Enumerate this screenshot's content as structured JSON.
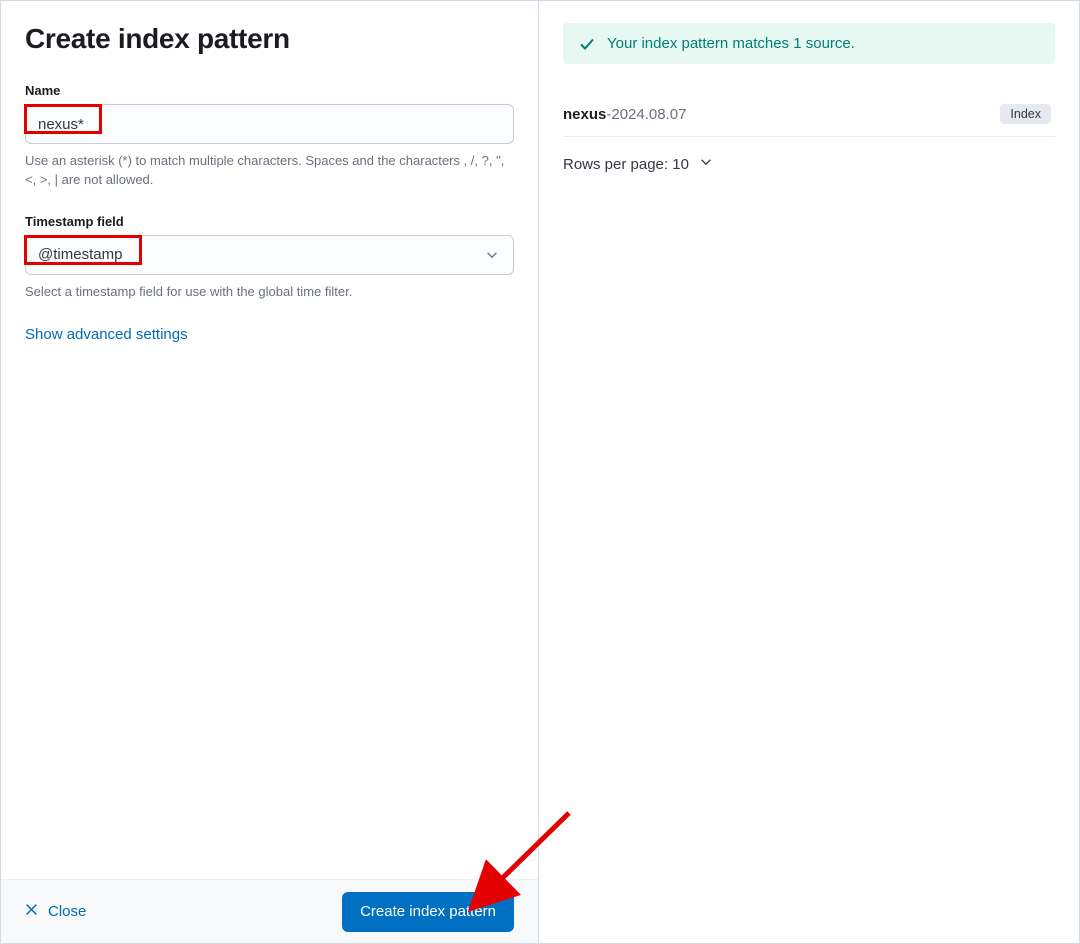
{
  "title": "Create index pattern",
  "name_field": {
    "label": "Name",
    "value": "nexus*",
    "help": "Use an asterisk (*) to match multiple characters. Spaces and the characters , /, ?, \", <, >, | are not allowed."
  },
  "timestamp_field": {
    "label": "Timestamp field",
    "value": "@timestamp",
    "help": "Select a timestamp field for use with the global time filter."
  },
  "advanced_link": "Show advanced settings",
  "footer": {
    "close": "Close",
    "create": "Create index pattern"
  },
  "callout": "Your index pattern matches 1 source.",
  "match": {
    "bold": "nexus",
    "rest": "-2024.08.07",
    "badge": "Index"
  },
  "rows_per_page": "Rows per page: 10"
}
